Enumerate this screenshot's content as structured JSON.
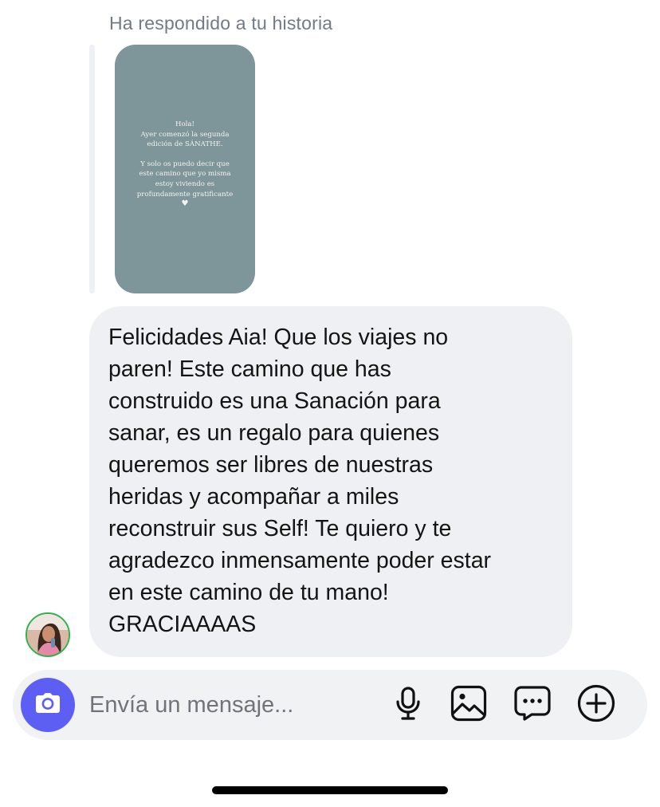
{
  "thread": {
    "story_reply_caption": "Ha respondido a tu historia",
    "story": {
      "lines_1": "Hola!\nAyer comenzó la segunda\nedición de SÁNATHE.",
      "lines_2": "Y solo os puedo decir que\neste camino que yo misma\nestoy viviendo es\nprofundamente gratificante",
      "heart": "♥",
      "background_color": "#7e9699"
    },
    "message": {
      "text": "Felicidades Aia! Que los viajes no\nparen! Este camino que has\nconstruido es una Sanación para\nsanar, es un regalo para quienes\nqueremos ser libres de nuestras\nheridas y acompañar a miles\nreconstruir sus Self! Te quiero y te\nagradezco inmensamente poder estar\nen este camino de tu mano!\nGRACIAAAAS",
      "bubble_color": "#eff0f3"
    },
    "avatar_ring_color": "#2db34a"
  },
  "composer": {
    "placeholder": "Envía un mensaje...",
    "camera_icon": "camera-icon",
    "icons": [
      "microphone-icon",
      "photo-gallery-icon",
      "sticker-chat-icon",
      "add-icon"
    ],
    "accent_color": "#5c5ef4"
  }
}
